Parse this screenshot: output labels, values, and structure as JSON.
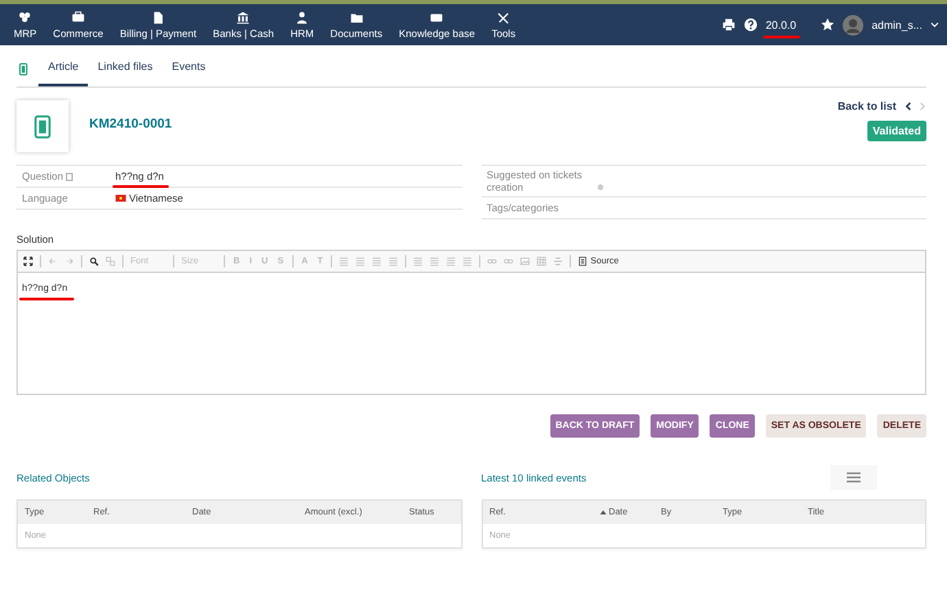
{
  "topbar": {
    "menu": [
      {
        "label": "MRP",
        "kind": "mrp"
      },
      {
        "label": "Commerce",
        "kind": "briefcase"
      },
      {
        "label": "Billing | Payment",
        "kind": "file"
      },
      {
        "label": "Banks | Cash",
        "kind": "bank"
      },
      {
        "label": "HRM",
        "kind": "user"
      },
      {
        "label": "Documents",
        "kind": "folder"
      },
      {
        "label": "Knowledge base",
        "kind": "card"
      },
      {
        "label": "Tools",
        "kind": "tools"
      }
    ],
    "version": "20.0.0",
    "version_marked": true,
    "user": "admin_s..."
  },
  "tabs": [
    {
      "label": "Article",
      "selected": true
    },
    {
      "label": "Linked files",
      "selected": false
    },
    {
      "label": "Events",
      "selected": false
    }
  ],
  "record": {
    "ref": "KM2410-0001",
    "back_link": "Back to list",
    "status": "Validated"
  },
  "fields_left": [
    {
      "label": "Question",
      "value": "h??ng d?n",
      "kind": "text",
      "marked": true
    },
    {
      "label": "Language",
      "value": "Vietnamese",
      "kind": "flag",
      "marked": false
    }
  ],
  "fields_right": [
    {
      "label": "Suggested on tickets creation",
      "kind": "info"
    },
    {
      "label": "Tags/categories",
      "kind": "plain"
    }
  ],
  "solution": {
    "label": "Solution",
    "content": "h??ng d?n",
    "marked": true,
    "toolbar": [
      {
        "kind": "maximize",
        "disabled": false
      },
      {
        "kind": "sep"
      },
      {
        "kind": "undo",
        "disabled": true
      },
      {
        "kind": "redo",
        "disabled": true
      },
      {
        "kind": "sep"
      },
      {
        "kind": "find",
        "disabled": false
      },
      {
        "kind": "replace",
        "disabled": true
      },
      {
        "kind": "sep"
      },
      {
        "kind": "select",
        "label": "Font",
        "disabled": true
      },
      {
        "kind": "sep"
      },
      {
        "kind": "select",
        "label": "Size",
        "disabled": true
      },
      {
        "kind": "sep"
      },
      {
        "kind": "glyph",
        "label": "B",
        "disabled": true
      },
      {
        "kind": "glyph",
        "label": "I",
        "disabled": true
      },
      {
        "kind": "glyph",
        "label": "U",
        "disabled": true
      },
      {
        "kind": "glyph",
        "label": "S",
        "disabled": true
      },
      {
        "kind": "sep"
      },
      {
        "kind": "glyph",
        "label": "A",
        "disabled": true
      },
      {
        "kind": "glyph",
        "label": "T",
        "disabled": true
      },
      {
        "kind": "sep"
      },
      {
        "kind": "lines",
        "disabled": true
      },
      {
        "kind": "lines",
        "disabled": true
      },
      {
        "kind": "lines",
        "disabled": true
      },
      {
        "kind": "lines",
        "disabled": true
      },
      {
        "kind": "sep"
      },
      {
        "kind": "lines",
        "disabled": true
      },
      {
        "kind": "lines",
        "disabled": true
      },
      {
        "kind": "lines",
        "disabled": true
      },
      {
        "kind": "lines",
        "disabled": true
      },
      {
        "kind": "sep"
      },
      {
        "kind": "link",
        "disabled": true
      },
      {
        "kind": "link",
        "disabled": true
      },
      {
        "kind": "image",
        "disabled": true
      },
      {
        "kind": "table",
        "disabled": true
      },
      {
        "kind": "rule",
        "disabled": true
      },
      {
        "kind": "sep"
      },
      {
        "kind": "source",
        "label": "Source",
        "disabled": false
      }
    ]
  },
  "actions": [
    {
      "label": "BACK TO DRAFT",
      "kind": "primary"
    },
    {
      "label": "MODIFY",
      "kind": "primary"
    },
    {
      "label": "CLONE",
      "kind": "primary"
    },
    {
      "label": "SET AS OBSOLETE",
      "kind": "secondary"
    },
    {
      "label": "DELETE",
      "kind": "secondary"
    }
  ],
  "related": {
    "title": "Related Objects",
    "columns": [
      "Type",
      "Ref.",
      "Date",
      "Amount (excl.)",
      "Status"
    ],
    "empty": "None"
  },
  "events": {
    "title": "Latest 10 linked events",
    "columns": [
      {
        "label": "Ref.",
        "sorted": false
      },
      {
        "label": "Date",
        "sorted": true
      },
      {
        "label": "By",
        "sorted": false
      },
      {
        "label": "Type",
        "sorted": false
      },
      {
        "label": "Title",
        "sorted": false
      }
    ],
    "empty": "None"
  }
}
